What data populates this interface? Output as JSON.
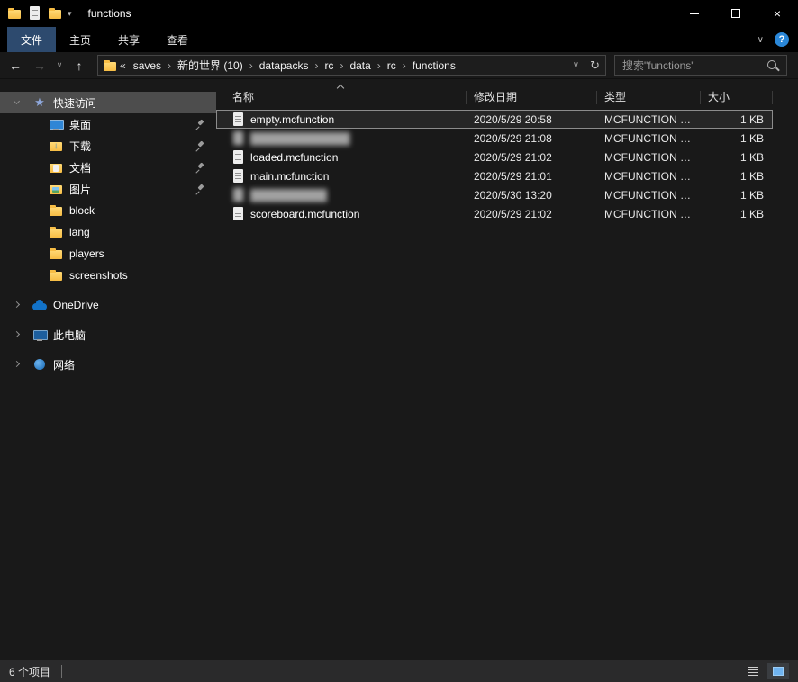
{
  "window": {
    "title": "functions"
  },
  "icons": {
    "close": "×",
    "back": "←",
    "forward": "→",
    "up": "↑",
    "chevron_down": "∨",
    "small_dropdown": "▾",
    "refresh": "↻"
  },
  "colors": {
    "titlebar": "#000000",
    "panel_background": "#191919",
    "active_tab_blue": "#2d4a6e",
    "sidebar_selection": "#4d4d4d",
    "folder_yellow": "#f7bd45",
    "help_blue": "#2a87d8"
  },
  "ribbon": {
    "tabs": [
      {
        "label": "文件",
        "active": true
      },
      {
        "label": "主页",
        "active": false
      },
      {
        "label": "共享",
        "active": false
      },
      {
        "label": "查看",
        "active": false
      }
    ],
    "help": "?"
  },
  "navbar": {
    "address": {
      "overflow": "«",
      "separator": "›",
      "crumbs": [
        "saves",
        "新的世界 (10)",
        "datapacks",
        "rc",
        "data",
        "rc",
        "functions"
      ]
    },
    "search": {
      "placeholder": "搜索\"functions\""
    }
  },
  "sidebar": {
    "items": [
      {
        "label": "快速访问",
        "icon": "star",
        "level": 0,
        "selected": true,
        "expanded": true
      },
      {
        "label": "桌面",
        "icon": "desktop",
        "level": 1,
        "pinned": true
      },
      {
        "label": "下载",
        "icon": "download",
        "level": 1,
        "pinned": true
      },
      {
        "label": "文档",
        "icon": "document",
        "level": 1,
        "pinned": true
      },
      {
        "label": "图片",
        "icon": "picture",
        "level": 1,
        "pinned": true
      },
      {
        "label": "block",
        "icon": "folder",
        "level": 1
      },
      {
        "label": "lang",
        "icon": "folder",
        "level": 1
      },
      {
        "label": "players",
        "icon": "folder",
        "level": 1
      },
      {
        "label": "screenshots",
        "icon": "folder",
        "level": 1
      },
      {
        "label": "OneDrive",
        "icon": "cloud",
        "level": 0,
        "group_start": true
      },
      {
        "label": "此电脑",
        "icon": "computer",
        "level": 0,
        "group_start": true
      },
      {
        "label": "网络",
        "icon": "network",
        "level": 0,
        "group_start": true
      }
    ]
  },
  "filelist": {
    "columns": [
      {
        "label": "名称",
        "sorted": true
      },
      {
        "label": "修改日期"
      },
      {
        "label": "类型"
      },
      {
        "label": "大小"
      }
    ],
    "rows": [
      {
        "name": "empty.mcfunction",
        "date": "2020/5/29 20:58",
        "type": "MCFUNCTION …",
        "size": "1 KB",
        "selected": true
      },
      {
        "name": "█████████████",
        "date": "2020/5/29 21:08",
        "type": "MCFUNCTION …",
        "size": "1 KB",
        "blurred": true
      },
      {
        "name": "loaded.mcfunction",
        "date": "2020/5/29 21:02",
        "type": "MCFUNCTION …",
        "size": "1 KB"
      },
      {
        "name": "main.mcfunction",
        "date": "2020/5/29 21:01",
        "type": "MCFUNCTION …",
        "size": "1 KB"
      },
      {
        "name": "██████████",
        "date": "2020/5/30 13:20",
        "type": "MCFUNCTION …",
        "size": "1 KB",
        "blurred": true
      },
      {
        "name": "scoreboard.mcfunction",
        "date": "2020/5/29 21:02",
        "type": "MCFUNCTION …",
        "size": "1 KB"
      }
    ]
  },
  "statusbar": {
    "items_count": "6 个项目"
  }
}
